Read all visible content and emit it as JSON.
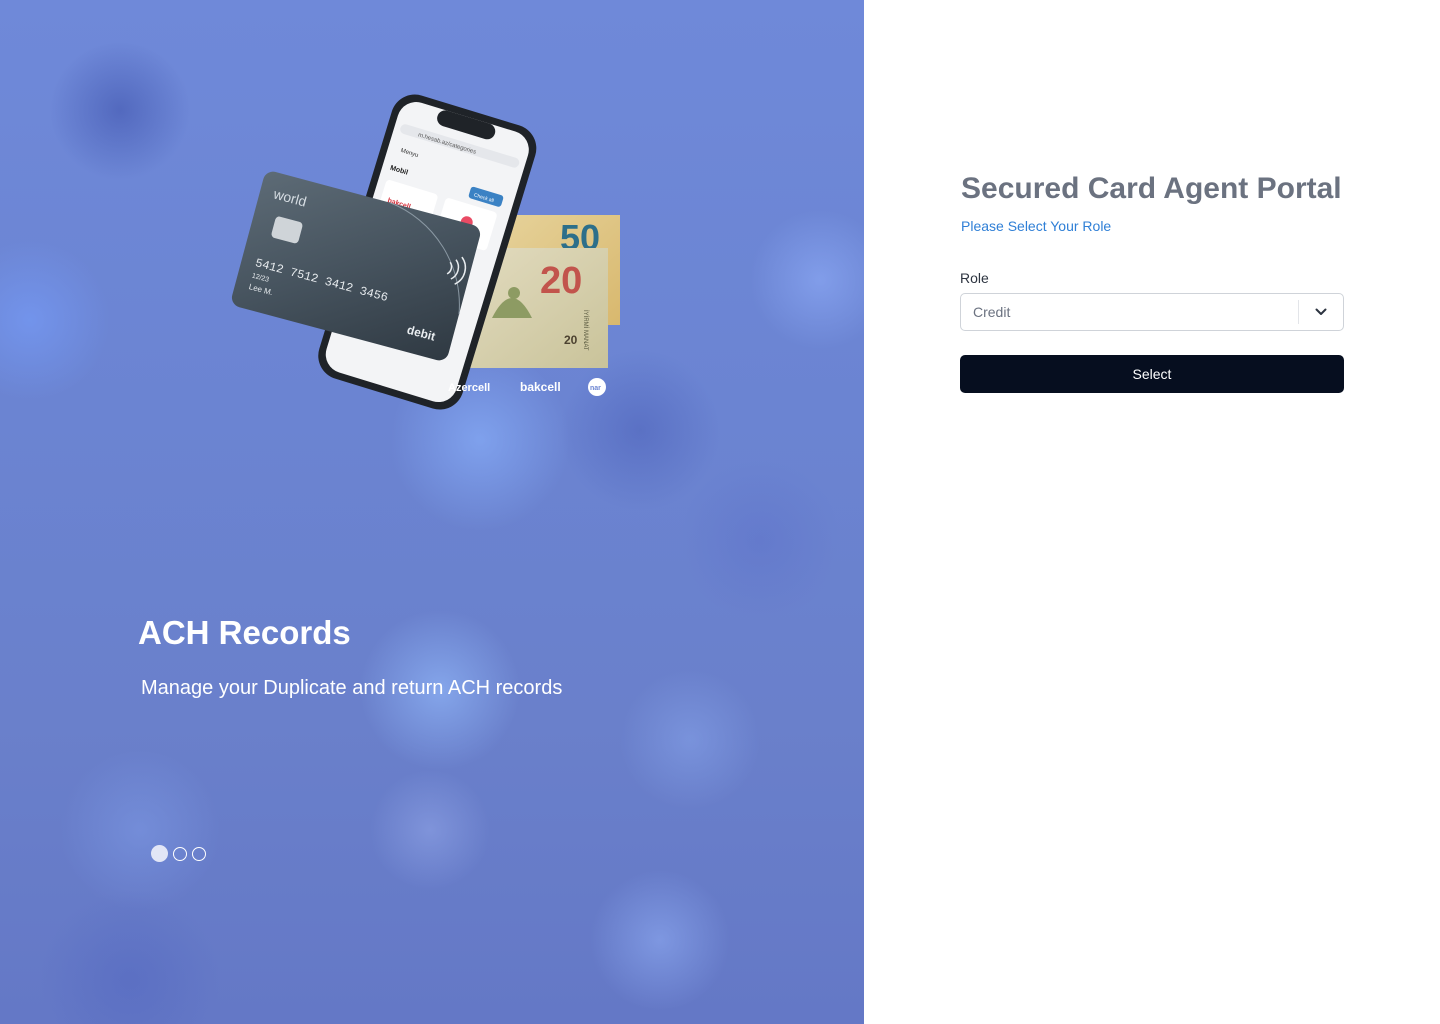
{
  "hero": {
    "slide_title": "ACH Records",
    "slide_description": "Manage your Duplicate and return ACH records",
    "illustration": {
      "card_brand": "world",
      "card_number": "5412 7512 3412 3456",
      "card_expiry": "12/23",
      "card_holder": "Lee M.",
      "card_type": "debit",
      "phone_url": "m.hesab.az/categories",
      "phone_menu": "Menyu",
      "phone_section": "Mobil",
      "phone_button": "Check all",
      "phone_item": "bakcell",
      "banknote_50": "50",
      "banknote_20": "20",
      "banknote_20_small": "20",
      "banknote_text": "İYİRMİ MANAT",
      "partner_1": "Azercell",
      "partner_2": "bakcell",
      "partner_3": "nar"
    },
    "carousel": {
      "count": 3,
      "active_index": 0
    }
  },
  "form": {
    "title": "Secured Card Agent Portal",
    "subtitle": "Please Select Your Role",
    "role_label": "Role",
    "role_value": "Credit",
    "submit_label": "Select"
  },
  "colors": {
    "primary_button": "#060e1f",
    "subtitle_link": "#2f7fd6",
    "hero_background": "#6b84d2"
  }
}
